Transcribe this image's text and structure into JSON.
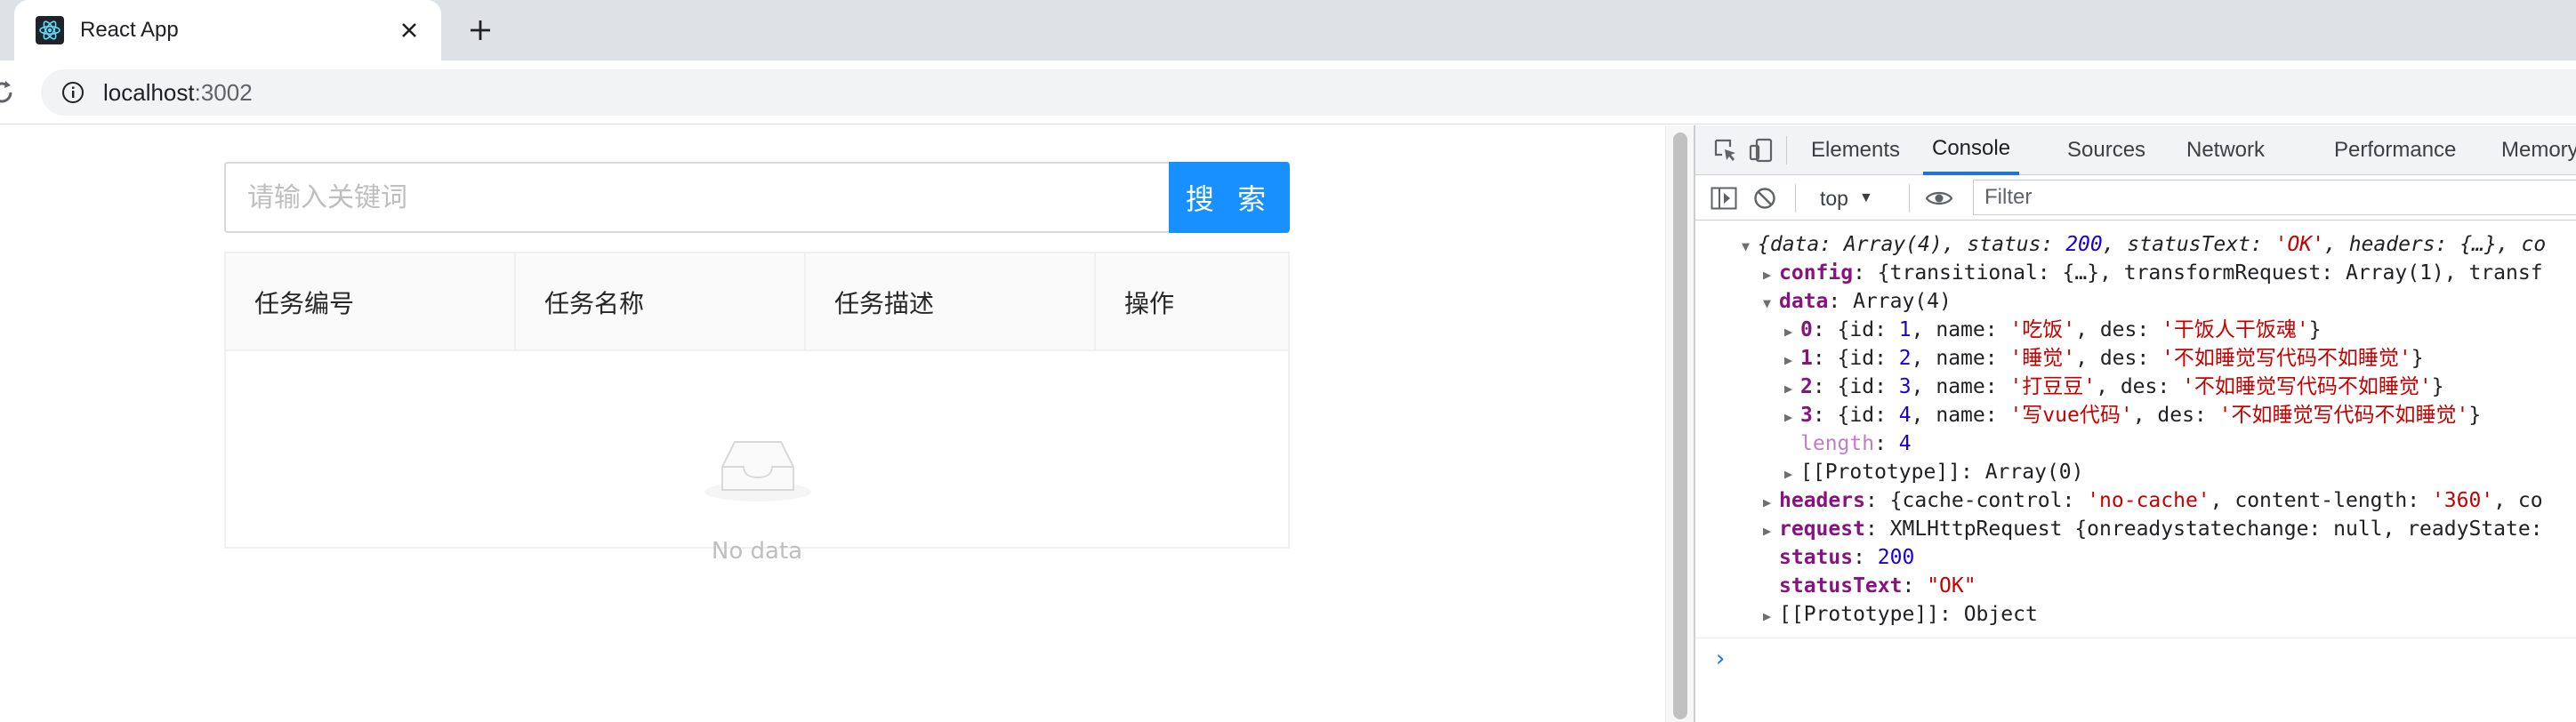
{
  "browser": {
    "tab_title": "React App",
    "url_host": "localhost",
    "url_port": ":3002"
  },
  "page": {
    "search_placeholder": "请输入关键词",
    "search_button": "搜 索",
    "columns": [
      "任务编号",
      "任务名称",
      "任务描述",
      "操作"
    ],
    "empty_text": "No data"
  },
  "devtools": {
    "tabs": [
      "Elements",
      "Console",
      "Sources",
      "Network",
      "Performance",
      "Memory"
    ],
    "active_tab": "Console",
    "context": "top",
    "filter_placeholder": "Filter",
    "console_lines": [
      "{data: Array(4), status: 200, statusText: 'OK', headers: {…}, co",
      "config: {transitional: {…}, transformRequest: Array(1), transf",
      "data: Array(4)",
      "0: {id: 1, name: '吃饭', des: '干饭人干饭魂'}",
      "1: {id: 2, name: '睡觉', des: '不如睡觉写代码不如睡觉'}",
      "2: {id: 3, name: '打豆豆', des: '不如睡觉写代码不如睡觉'}",
      "3: {id: 4, name: '写vue代码', des: '不如睡觉写代码不如睡觉'}",
      "length: 4",
      "[[Prototype]]: Array(0)",
      "headers: {cache-control: 'no-cache', content-length: '360', co",
      "request: XMLHttpRequest {onreadystatechange: null, readyState:",
      "status: 200",
      "statusText: \"OK\"",
      "[[Prototype]]: Object"
    ]
  }
}
